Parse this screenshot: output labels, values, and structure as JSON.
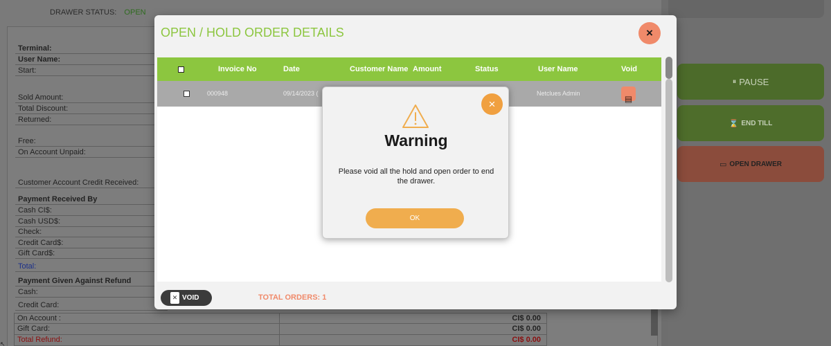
{
  "drawer": {
    "status_label": "DRAWER STATUS:",
    "status_value": "OPEN"
  },
  "report": {
    "rows": [
      {
        "label": "Terminal:",
        "style": "bold"
      },
      {
        "label": "User Name:",
        "style": "bold"
      },
      {
        "label": "Start:",
        "style": ""
      },
      {
        "label": "Sold Amount:",
        "style": ""
      },
      {
        "label": "Total Discount:",
        "style": ""
      },
      {
        "label": "Returned:",
        "style": ""
      },
      {
        "label": "Free:",
        "style": ""
      },
      {
        "label": "On Account Unpaid:",
        "style": ""
      },
      {
        "label": "Customer Account Credit Received:",
        "style": ""
      },
      {
        "label": "Payment Received By",
        "style": "bold"
      },
      {
        "label": "Cash CI$:",
        "style": ""
      },
      {
        "label": "Cash USD$:",
        "style": ""
      },
      {
        "label": "Check:",
        "style": ""
      },
      {
        "label": "Credit Card$:",
        "style": ""
      },
      {
        "label": "Gift Card$:",
        "style": ""
      },
      {
        "label": "Total:",
        "style": "blue"
      },
      {
        "label": "Payment Given Against Refund",
        "style": "bold"
      },
      {
        "label": "Cash:",
        "style": ""
      },
      {
        "label": "Credit Card:",
        "style": ""
      }
    ],
    "bottom": [
      {
        "label": "On Account :",
        "amount": "CI$ 0.00"
      },
      {
        "label": "Gift Card:",
        "amount": "CI$ 0.00"
      },
      {
        "label": "Total Refund:",
        "amount": "CI$ 0.00",
        "style": "red"
      }
    ]
  },
  "right_panel": {
    "pause": "PAUSE",
    "end_till": "END TILL",
    "open_drawer": "OPEN DRAWER"
  },
  "modal": {
    "title": "OPEN / HOLD ORDER DETAILS",
    "close": "×",
    "columns": [
      "Invoice No",
      "Date",
      "Customer Name",
      "Amount",
      "Status",
      "User Name",
      "Void"
    ],
    "rows": [
      {
        "invoice_no": "000948",
        "date": "09/14/2023 (",
        "customer_name": "",
        "amount": "",
        "status": "",
        "user_name": "Netclues Admin"
      }
    ],
    "void_button": "VOID",
    "total_orders": "TOTAL ORDERS: 1"
  },
  "warning": {
    "title": "Warning",
    "message": "Please void all the hold and open order to end the drawer.",
    "ok": "OK",
    "close": "×"
  },
  "colors": {
    "accent_green": "#8cc63f",
    "accent_orange": "#f08a6a",
    "ok_orange": "#f0ad4e"
  }
}
